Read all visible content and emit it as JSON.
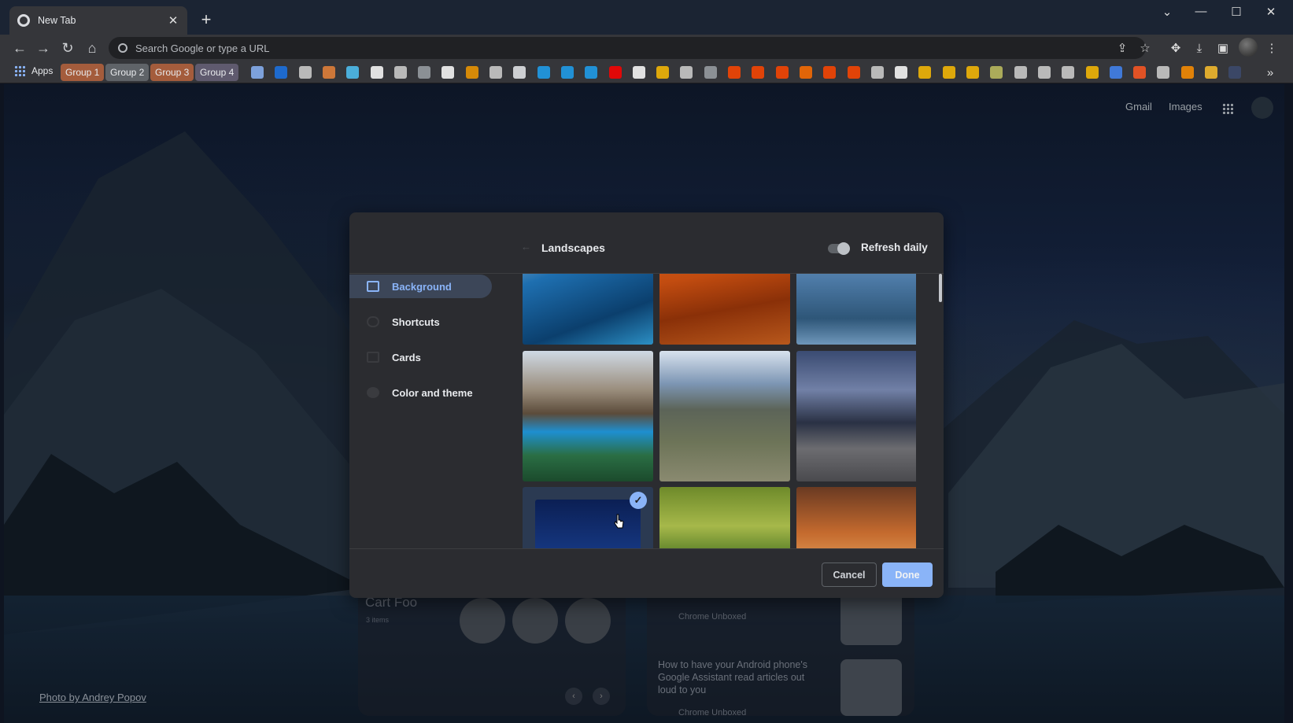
{
  "browser": {
    "tab_title": "New Tab",
    "tab_close": "✕",
    "new_tab": "+",
    "window_controls": [
      "⌄",
      "—",
      "☐",
      "✕"
    ],
    "omnibox_placeholder": "Search Google or type a URL",
    "nav_icons": [
      "back-icon",
      "forward-icon",
      "reload-icon",
      "home-icon"
    ],
    "toolbar_icons": [
      "share-icon",
      "star-icon",
      "extensions-icon",
      "download-icon",
      "side-panel-icon",
      "profile-avatar",
      "menu-icon"
    ]
  },
  "bookmarks": {
    "apps_label": "Apps",
    "groups": [
      {
        "label": "Group 1",
        "color": "#a45c3c"
      },
      {
        "label": "Group 2",
        "color": "#5f6368"
      },
      {
        "label": "Group 3",
        "color": "#a45c3c"
      },
      {
        "label": "Group 4",
        "color": "#5f5a6e"
      }
    ],
    "overflow": "»",
    "icon_colors": [
      "#8ab4f8",
      "#1a73e8",
      "#d0d0d0",
      "#e8833a",
      "#4fc3f7",
      "#ffffff",
      "#d0d0d0",
      "#9aa0a6",
      "#ffffff",
      "#f29900",
      "#d0d0d0",
      "#e8eaed",
      "#1da1f2",
      "#1da1f2",
      "#1da1f2",
      "#ff0000",
      "#ffffff",
      "#fbbc04",
      "#d0d0d0",
      "#9aa0a6",
      "#ff4500",
      "#ff4500",
      "#ff4500",
      "#ff6d00",
      "#ff4500",
      "#ff4500",
      "#d0d0d0",
      "#ffffff",
      "#fbbc04",
      "#fbbc04",
      "#fbbc04",
      "#c0c060",
      "#d0d0d0",
      "#d0d0d0",
      "#d0d0d0",
      "#fbbc04",
      "#4285f4",
      "#ff5722",
      "#d0d0d0",
      "#ff8f00",
      "#fbc02d",
      "#3c4a6e"
    ]
  },
  "ntp": {
    "gmail": "Gmail",
    "images": "Images",
    "photo_credit": "Photo by Andrey Popov",
    "cart": {
      "title": "Cart Foo",
      "count": "3 items"
    },
    "news": [
      {
        "source": "Chrome Unboxed"
      },
      {
        "headline": [
          "How to have your Android phone's",
          "Google Assistant read articles out",
          "loud to you"
        ],
        "source": "Chrome Unboxed"
      }
    ],
    "pager": [
      "‹",
      "›"
    ]
  },
  "dialog": {
    "title": "Landscapes",
    "refresh_label": "Refresh daily",
    "refresh_on": false,
    "nav": [
      {
        "label": "Background",
        "active": true
      },
      {
        "label": "Shortcuts",
        "active": false
      },
      {
        "label": "Cards",
        "active": false
      },
      {
        "label": "Color and theme",
        "active": false
      }
    ],
    "cancel": "Cancel",
    "done": "Done",
    "check_mark": "✓",
    "accent": "#8ab4f8"
  }
}
